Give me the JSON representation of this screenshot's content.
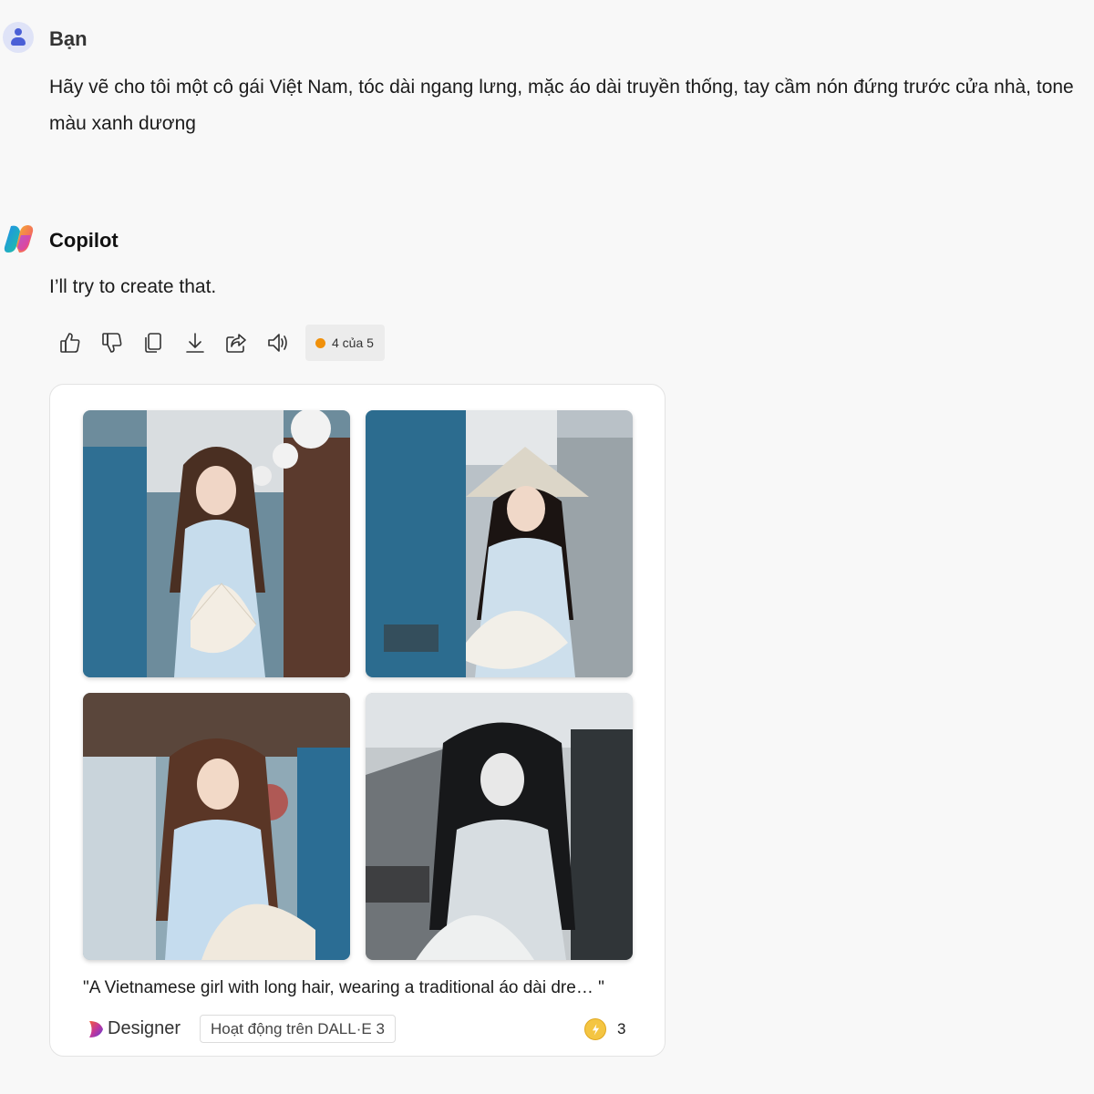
{
  "user": {
    "name": "Bạn",
    "message": "Hãy vẽ cho tôi một cô gái Việt Nam, tóc dài ngang lưng, mặc áo dài truyền thống, tay cầm nón đứng trước cửa nhà, tone màu xanh dương"
  },
  "copilot": {
    "name": "Copilot",
    "message": "I’ll try to create that."
  },
  "actions": [
    {
      "name": "thumbs-up-icon"
    },
    {
      "name": "thumbs-down-icon"
    },
    {
      "name": "copy-icon"
    },
    {
      "name": "download-icon"
    },
    {
      "name": "share-icon"
    },
    {
      "name": "read-aloud-icon"
    }
  ],
  "page_indicator": {
    "label": "4 của 5",
    "dot_color": "#f0900a"
  },
  "image_card": {
    "caption": "\"A Vietnamese girl with long hair, wearing a traditional áo dài dre… \"",
    "designer_label": "Designer",
    "dalle_badge": "Hoạt động trên DALL·E 3",
    "boost_count": "3",
    "images": [
      {
        "alt": "generated-image-1"
      },
      {
        "alt": "generated-image-2"
      },
      {
        "alt": "generated-image-3"
      },
      {
        "alt": "generated-image-4"
      }
    ]
  }
}
